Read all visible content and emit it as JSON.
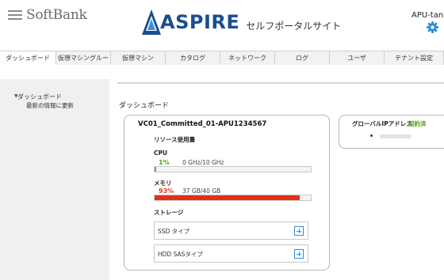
{
  "header": {
    "softbank_logo": "SoftBank",
    "aspire_logo": "ASPIRE",
    "portal_title": "セルフポータルサイト",
    "user": "APU-tan"
  },
  "tabs": [
    {
      "label": "ダッシュボード",
      "active": true
    },
    {
      "label": "仮想マシングルー",
      "active": false
    },
    {
      "label": "仮想マシン",
      "active": false
    },
    {
      "label": "カタログ",
      "active": false
    },
    {
      "label": "ネットワーク",
      "active": false
    },
    {
      "label": "ログ",
      "active": false
    },
    {
      "label": "ユーザ",
      "active": false
    },
    {
      "label": "テナント設定",
      "active": false
    }
  ],
  "sidebar": {
    "item": "ダッシュボード",
    "subitem": "最新の情報に更新"
  },
  "main": {
    "title": "ダッシュボード",
    "vm_card": {
      "name": "VC01_Committed_01-APU1234567",
      "resource_label": "リソース使用量",
      "cpu": {
        "label": "CPU",
        "percent_text": "1%",
        "usage": "0 GHz/10 GHz",
        "fraction": 0.01
      },
      "memory": {
        "label": "メモリ",
        "percent_text": "93%",
        "usage": "37 GB/40 GB",
        "fraction": 0.93
      },
      "storage": {
        "label": "ストレージ",
        "types": [
          "SSD タイプ",
          "HDD SASタイプ"
        ]
      }
    },
    "global_ip_card": {
      "title": "グローバルIPアドレス",
      "status": "契約済"
    }
  },
  "colors": {
    "cpu_bar": "#7ab23a",
    "memory_bar": "#e62e17",
    "brand_blue": "#1a4e8c",
    "accent": "#2d8fd0"
  }
}
